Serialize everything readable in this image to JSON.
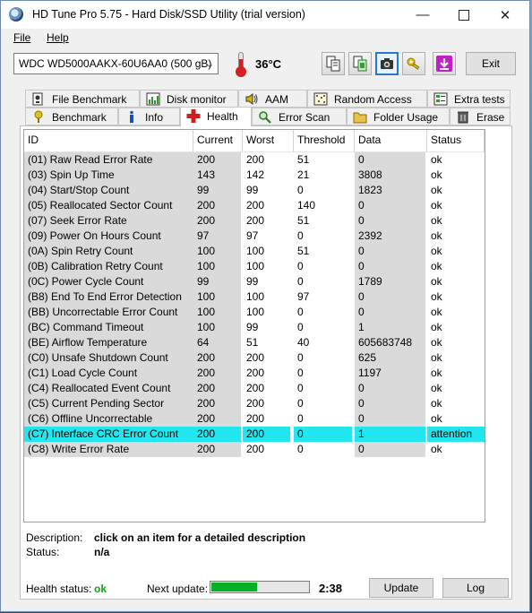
{
  "window": {
    "title": "HD Tune Pro 5.75 - Hard Disk/SSD Utility (trial version)"
  },
  "menu": {
    "file": "File",
    "help": "Help"
  },
  "toolbar": {
    "drive": "WDC WD5000AAKX-60U6AA0 (500 gB)",
    "temperature": "36°C",
    "exit_label": "Exit"
  },
  "tabs_top": [
    "File Benchmark",
    "Disk monitor",
    "AAM",
    "Random Access",
    "Extra tests"
  ],
  "tabs_bottom": [
    "Benchmark",
    "Info",
    "Health",
    "Error Scan",
    "Folder Usage",
    "Erase"
  ],
  "active_tab": "Health",
  "table": {
    "columns": [
      "ID",
      "Current",
      "Worst",
      "Threshold",
      "Data",
      "Status"
    ],
    "rows": [
      {
        "id": "(01) Raw Read Error Rate",
        "current": "200",
        "worst": "200",
        "threshold": "51",
        "data": "0",
        "status": "ok"
      },
      {
        "id": "(03) Spin Up Time",
        "current": "143",
        "worst": "142",
        "threshold": "21",
        "data": "3808",
        "status": "ok"
      },
      {
        "id": "(04) Start/Stop Count",
        "current": "99",
        "worst": "99",
        "threshold": "0",
        "data": "1823",
        "status": "ok"
      },
      {
        "id": "(05) Reallocated Sector Count",
        "current": "200",
        "worst": "200",
        "threshold": "140",
        "data": "0",
        "status": "ok"
      },
      {
        "id": "(07) Seek Error Rate",
        "current": "200",
        "worst": "200",
        "threshold": "51",
        "data": "0",
        "status": "ok"
      },
      {
        "id": "(09) Power On Hours Count",
        "current": "97",
        "worst": "97",
        "threshold": "0",
        "data": "2392",
        "status": "ok"
      },
      {
        "id": "(0A) Spin Retry Count",
        "current": "100",
        "worst": "100",
        "threshold": "51",
        "data": "0",
        "status": "ok"
      },
      {
        "id": "(0B) Calibration Retry Count",
        "current": "100",
        "worst": "100",
        "threshold": "0",
        "data": "0",
        "status": "ok"
      },
      {
        "id": "(0C) Power Cycle Count",
        "current": "99",
        "worst": "99",
        "threshold": "0",
        "data": "1789",
        "status": "ok"
      },
      {
        "id": "(B8) End To End Error Detection",
        "current": "100",
        "worst": "100",
        "threshold": "97",
        "data": "0",
        "status": "ok"
      },
      {
        "id": "(BB) Uncorrectable Error Count",
        "current": "100",
        "worst": "100",
        "threshold": "0",
        "data": "0",
        "status": "ok"
      },
      {
        "id": "(BC) Command Timeout",
        "current": "100",
        "worst": "99",
        "threshold": "0",
        "data": "1",
        "status": "ok"
      },
      {
        "id": "(BE) Airflow Temperature",
        "current": "64",
        "worst": "51",
        "threshold": "40",
        "data": "605683748",
        "status": "ok"
      },
      {
        "id": "(C0) Unsafe Shutdown Count",
        "current": "200",
        "worst": "200",
        "threshold": "0",
        "data": "625",
        "status": "ok"
      },
      {
        "id": "(C1) Load Cycle Count",
        "current": "200",
        "worst": "200",
        "threshold": "0",
        "data": "1197",
        "status": "ok"
      },
      {
        "id": "(C4) Reallocated Event Count",
        "current": "200",
        "worst": "200",
        "threshold": "0",
        "data": "0",
        "status": "ok"
      },
      {
        "id": "(C5) Current Pending Sector",
        "current": "200",
        "worst": "200",
        "threshold": "0",
        "data": "0",
        "status": "ok"
      },
      {
        "id": "(C6) Offline Uncorrectable",
        "current": "200",
        "worst": "200",
        "threshold": "0",
        "data": "0",
        "status": "ok"
      },
      {
        "id": "(C7) Interface CRC Error Count",
        "current": "200",
        "worst": "200",
        "threshold": "0",
        "data": "1",
        "status": "attention",
        "highlight": true
      },
      {
        "id": "(C8) Write Error Rate",
        "current": "200",
        "worst": "200",
        "threshold": "0",
        "data": "0",
        "status": "ok"
      }
    ]
  },
  "details": {
    "description_label": "Description:",
    "description_value": "click on an item for a detailed description",
    "status_label": "Status:",
    "status_value": "n/a"
  },
  "footer": {
    "health_label": "Health status:",
    "health_value": "ok",
    "next_update_label": "Next update:",
    "next_update_progress": 0.47,
    "next_update_time": "2:38",
    "update_button": "Update",
    "log_button": "Log"
  },
  "colors": {
    "highlight": "#22e6ee",
    "ok_green": "#13a313",
    "progress": "#06b025",
    "selected_toolbar": "#2a77d1"
  },
  "icons": [
    "app-disk-icon",
    "thermometer-icon",
    "copy-icon",
    "copy-screen-icon",
    "camera-icon",
    "key-icon",
    "download-icon"
  ]
}
